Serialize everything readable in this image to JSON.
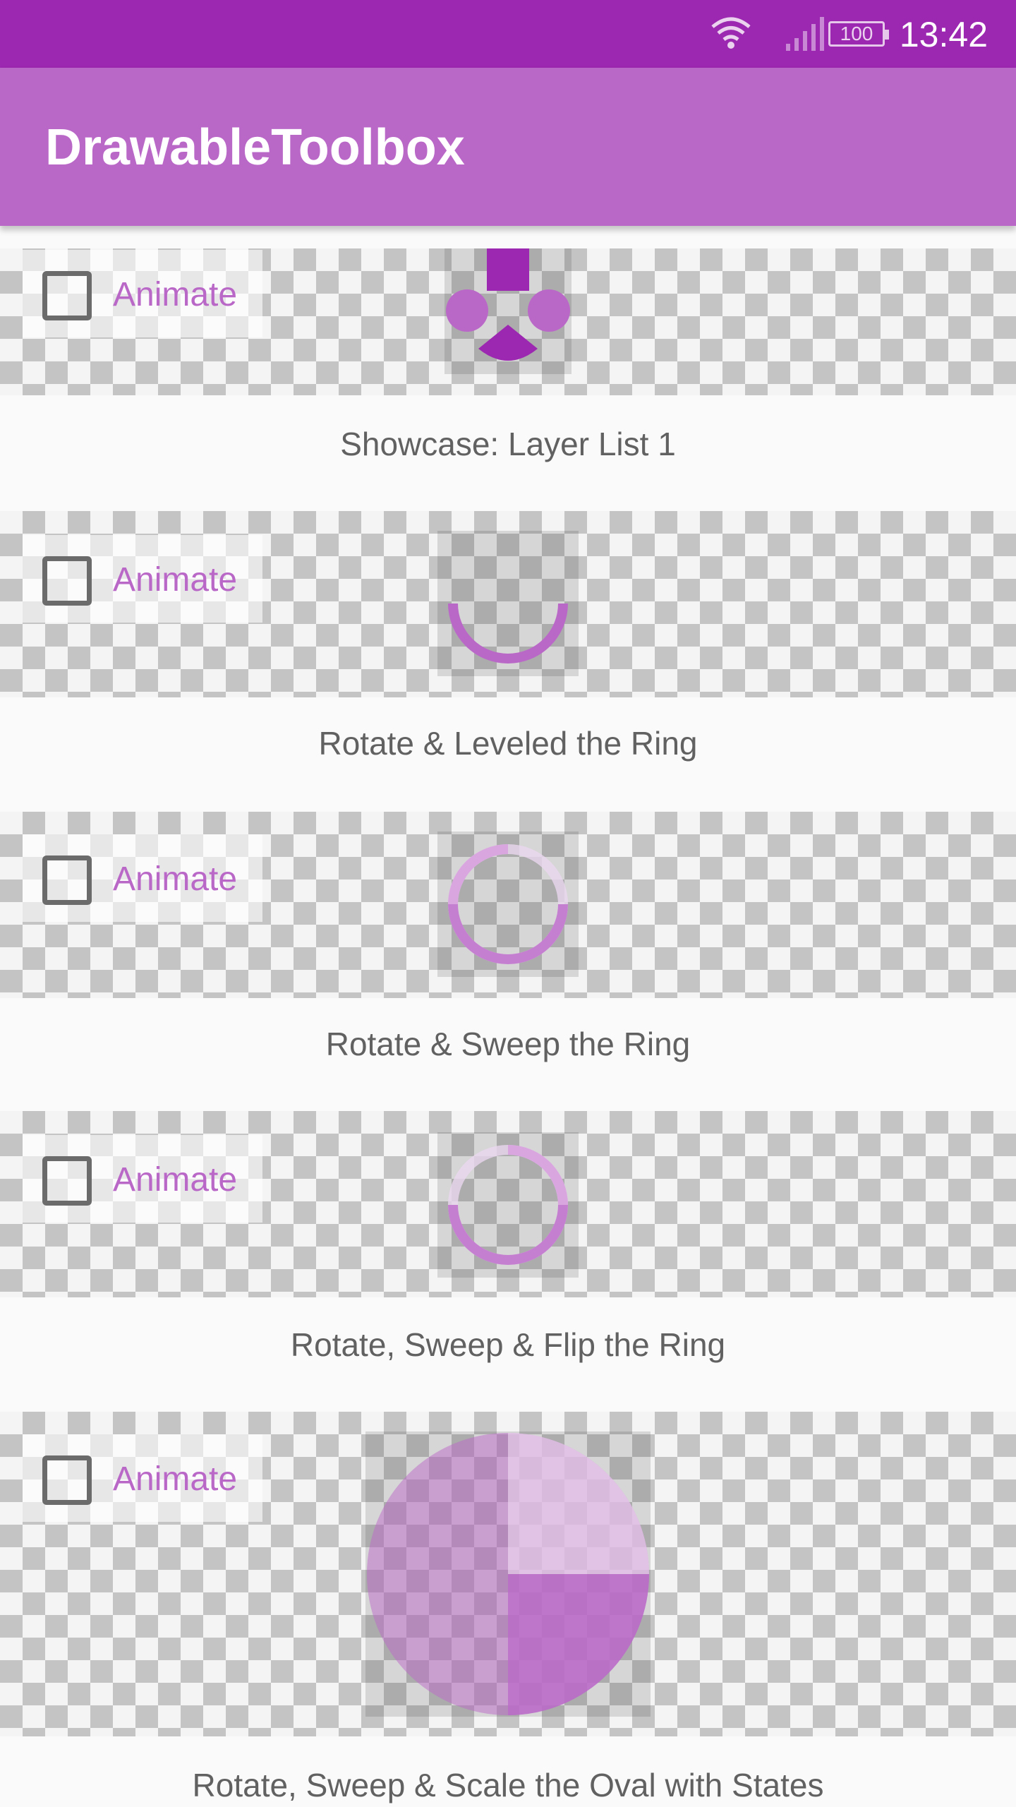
{
  "status_bar": {
    "time": "13:42",
    "battery": "100",
    "icons": [
      "wifi-icon",
      "signal-icon",
      "battery-icon"
    ]
  },
  "app_bar": {
    "title": "DrawableToolbox"
  },
  "colors": {
    "primary_dark": "#9c27b0",
    "primary": "#ba68c8",
    "accent": "#ba68c8",
    "checkbox": "#6b6b6b",
    "caption": "#616161"
  },
  "items": [
    {
      "checkbox_label": "Animate",
      "caption": "Showcase: Layer List 1"
    },
    {
      "checkbox_label": "Animate",
      "caption": "Rotate & Leveled the Ring"
    },
    {
      "checkbox_label": "Animate",
      "caption": "Rotate & Sweep the Ring"
    },
    {
      "checkbox_label": "Animate",
      "caption": "Rotate, Sweep & Flip the Ring"
    },
    {
      "checkbox_label": "Animate",
      "caption": "Rotate, Sweep & Scale the Oval with States"
    }
  ]
}
